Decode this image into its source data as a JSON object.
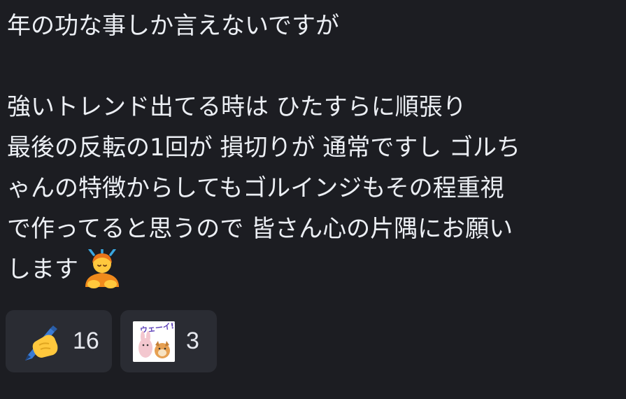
{
  "message": {
    "lines": [
      "年の功な事しか言えないですが",
      "",
      "強いトレンド出てる時は ひたすらに順張り",
      "最後の反転の1回が 損切りが 通常ですし ゴルち",
      "ゃんの特徴からしてもゴルインジもその程重視",
      "で作ってると思うので 皆さん心の片隅にお願い",
      "します"
    ],
    "trailing_emoji": "person-bowing-icon"
  },
  "reactions": [
    {
      "icon": "writing-hand-icon",
      "count": "16"
    },
    {
      "icon": "sticker-wee-icon",
      "sticker_text": "ウェーイ!!",
      "count": "3"
    }
  ],
  "colors": {
    "background": "#1c1d22",
    "reaction_bg": "#2a2c33",
    "text": "#eceff4"
  }
}
